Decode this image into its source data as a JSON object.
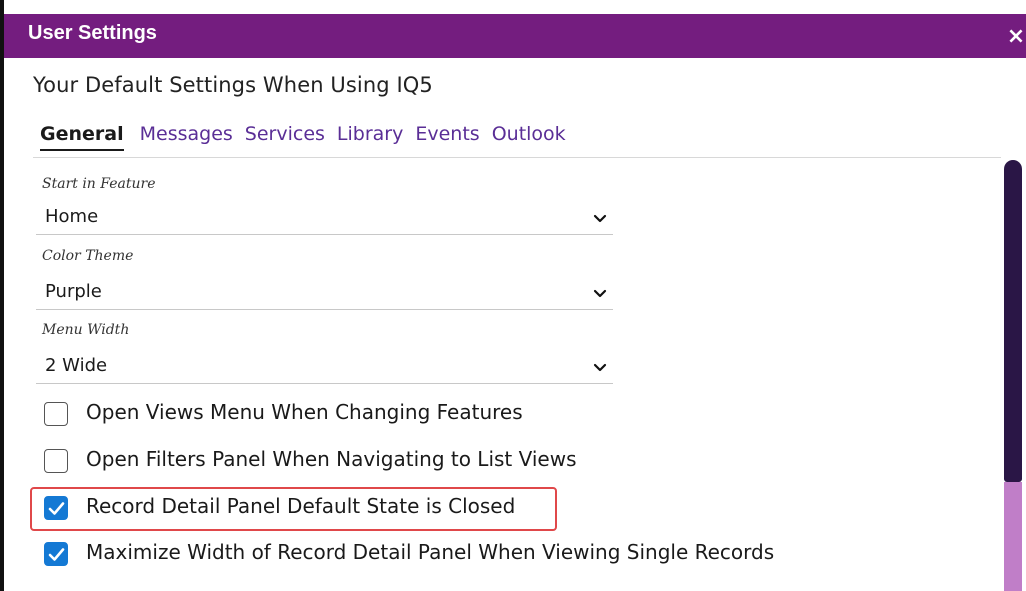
{
  "window": {
    "title": "User Settings",
    "close_glyph": "×",
    "titlebar_color": "#741d7f"
  },
  "heading": "Your Default Settings When Using IQ5",
  "tabs": [
    {
      "label": "General",
      "active": true
    },
    {
      "label": "Messages",
      "active": false
    },
    {
      "label": "Services",
      "active": false
    },
    {
      "label": "Library",
      "active": false
    },
    {
      "label": "Events",
      "active": false
    },
    {
      "label": "Outlook",
      "active": false
    }
  ],
  "fields": {
    "start_feature": {
      "label": "Start in Feature",
      "value": "Home"
    },
    "color_theme": {
      "label": "Color Theme",
      "value": "Purple"
    },
    "menu_width": {
      "label": "Menu Width",
      "value": "2 Wide"
    }
  },
  "checkboxes": [
    {
      "label": "Open Views Menu When Changing Features",
      "checked": false
    },
    {
      "label": "Open Filters Panel When Navigating to List Views",
      "checked": false
    },
    {
      "label": "Record Detail Panel Default State is Closed",
      "checked": true,
      "highlighted": true
    },
    {
      "label": "Maximize Width of Record Detail Panel When Viewing Single Records",
      "checked": true
    }
  ],
  "colors": {
    "accent": "#741d7f",
    "tab_link": "#5a2e96",
    "checkbox_checked": "#1479d4",
    "highlight": "#e0484a",
    "scrollbar_thumb": "#2a1646",
    "scrollbar_track": "#c07ec8"
  }
}
